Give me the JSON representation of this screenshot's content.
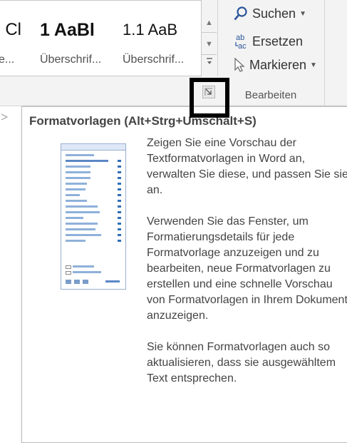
{
  "ribbon": {
    "styles_gallery": {
      "items": [
        {
          "preview": "ı Cl",
          "name": "e..."
        },
        {
          "preview": "1  AaBl",
          "name": "Überschrif..."
        },
        {
          "preview": "1.1  AaB",
          "name": "Überschrif..."
        }
      ]
    },
    "editing_group": {
      "find_label": "Suchen",
      "replace_label": "Ersetzen",
      "select_label": "Markieren",
      "group_label": "Bearbeiten"
    }
  },
  "tooltip": {
    "title": "Formatvorlagen (Alt+Strg+Umschalt+S)",
    "paragraphs": [
      "Zeigen Sie eine Vorschau der Textformatvorlagen in Word an, verwalten Sie diese, und passen Sie sie an.",
      "Verwenden Sie das Fenster, um Formatierungsdetails für jede Formatvorlage anzuzeigen und zu bearbeiten, neue Formatvorlagen zu erstellen und eine schnelle Vorschau von Formatvorlagen in Ihrem Dokument anzuzeigen.",
      "Sie können Formatvorlagen auch so aktualisieren, dass sie ausgewähltem Text entsprechen."
    ]
  },
  "icons": {
    "find": "magnifier-icon",
    "replace": "ab-ac-replace-icon",
    "select": "cursor-arrow-icon",
    "launcher": "dialog-launcher-icon"
  },
  "colors": {
    "ribbon_bg": "#f3f3f3",
    "icon_blue": "#2b579a",
    "highlight": "#000000"
  }
}
